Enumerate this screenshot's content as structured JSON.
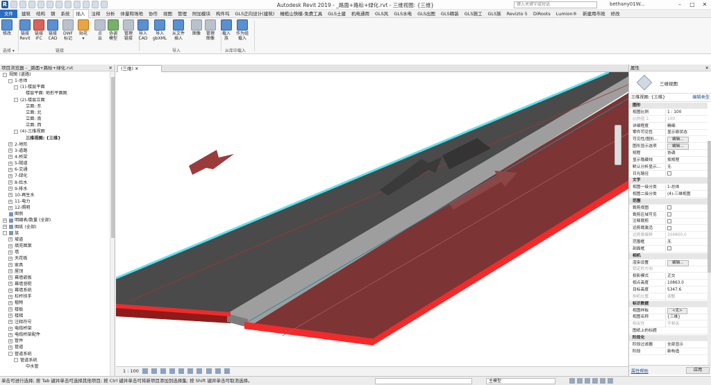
{
  "titlebar": {
    "title": "Autodesk Revit 2019 - _路面+路标+绿化.rvt - 三维视图: {三维}",
    "search_placeholder": "键入关键字或短语",
    "user": "bethany01W..."
  },
  "menu": [
    "文件",
    "建筑",
    "结构",
    "钢",
    "系统",
    "插入",
    "注释",
    "分析",
    "体量和场地",
    "协作",
    "视图",
    "管理",
    "附加模块",
    "构件坞",
    "GLS正向设计(建筑)",
    "橄榄山快模-免费工具",
    "GLS土建",
    "机电通用",
    "GLS风",
    "GLS水电",
    "GLS出图",
    "GLS精装",
    "GLS施工",
    "GLS族",
    "Revizto 5",
    "DiRoots",
    "Lumion®",
    "新建用市政",
    "修改"
  ],
  "menu_active": "插入",
  "ribbon": {
    "buttons": [
      {
        "label": "修改",
        "color": "blue"
      },
      {
        "label": "链接\nRevit",
        "color": "blue"
      },
      {
        "label": "链接\nIFC",
        "color": "red"
      },
      {
        "label": "链接\nCAD",
        "color": "blue"
      },
      {
        "label": "DWF\n标记",
        "color": "gray"
      },
      {
        "label": "贴花\n▾",
        "color": "orange"
      },
      {
        "label": "点\n云",
        "color": "gray"
      },
      {
        "label": "协调\n模型",
        "color": "green"
      },
      {
        "label": "管理\n链接",
        "color": "gray"
      },
      {
        "label": "导入\nCAD",
        "color": "blue"
      },
      {
        "label": "导入\ngbXML",
        "color": "blue"
      },
      {
        "label": "从文件\n插入",
        "color": "blue"
      },
      {
        "label": "图像",
        "color": "gray"
      },
      {
        "label": "管理\n图像",
        "color": "gray"
      },
      {
        "label": "载入\n族",
        "color": "blue"
      },
      {
        "label": "作为组\n载入",
        "color": "blue"
      }
    ],
    "panels": {
      "select": "选择 ▾",
      "link": "链接",
      "import": "导入",
      "load": "从库中载入"
    }
  },
  "browser": {
    "title": "项目浏览器 - _路面+路标+绿化.rvt",
    "items": [
      {
        "t": "视图 (道路)",
        "lvl": 0,
        "tog": "-"
      },
      {
        "t": "1-总体",
        "lvl": 1,
        "tog": "-"
      },
      {
        "t": "(1)-楼层平面",
        "lvl": 2,
        "tog": "-"
      },
      {
        "t": "楼层平面: 地形平面图",
        "lvl": 3,
        "tog": ""
      },
      {
        "t": "(2)-楼层立面",
        "lvl": 2,
        "tog": "-"
      },
      {
        "t": "立面: 东",
        "lvl": 3,
        "tog": ""
      },
      {
        "t": "立面: 北",
        "lvl": 3,
        "tog": ""
      },
      {
        "t": "立面: 南",
        "lvl": 3,
        "tog": ""
      },
      {
        "t": "立面: 西",
        "lvl": 3,
        "tog": ""
      },
      {
        "t": "(4)-三维视图",
        "lvl": 2,
        "tog": "-"
      },
      {
        "t": "三维视图: {三维}",
        "lvl": 3,
        "tog": "",
        "bold": true
      },
      {
        "t": "2-地形",
        "lvl": 1,
        "tog": "+"
      },
      {
        "t": "3-道路",
        "lvl": 1,
        "tog": "+"
      },
      {
        "t": "4-桥梁",
        "lvl": 1,
        "tog": "+"
      },
      {
        "t": "5-隧道",
        "lvl": 1,
        "tog": "+"
      },
      {
        "t": "6-交通",
        "lvl": 1,
        "tog": "+"
      },
      {
        "t": "7-绿化",
        "lvl": 1,
        "tog": "+"
      },
      {
        "t": "8-给水",
        "lvl": 1,
        "tog": "+"
      },
      {
        "t": "9-排水",
        "lvl": 1,
        "tog": "+"
      },
      {
        "t": "10-再生水",
        "lvl": 1,
        "tog": "+"
      },
      {
        "t": "11-电力",
        "lvl": 1,
        "tog": "+"
      },
      {
        "t": "12-照明",
        "lvl": 1,
        "tog": "+"
      },
      {
        "t": "图例",
        "lvl": 0,
        "tog": "",
        "icon": true
      },
      {
        "t": "明细表/数量 (全部)",
        "lvl": 0,
        "tog": "+",
        "icon": true
      },
      {
        "t": "图纸 (全部)",
        "lvl": 0,
        "tog": "+",
        "icon": true
      },
      {
        "t": "族",
        "lvl": 0,
        "tog": "-",
        "icon": true
      },
      {
        "t": "坡道",
        "lvl": 1,
        "tog": "+"
      },
      {
        "t": "填充图案",
        "lvl": 1,
        "tog": "+"
      },
      {
        "t": "墙",
        "lvl": 1,
        "tog": "+"
      },
      {
        "t": "天花板",
        "lvl": 1,
        "tog": "+"
      },
      {
        "t": "家具",
        "lvl": 1,
        "tog": "+"
      },
      {
        "t": "屋顶",
        "lvl": 1,
        "tog": "+"
      },
      {
        "t": "幕墙嵌板",
        "lvl": 1,
        "tog": "+"
      },
      {
        "t": "幕墙竖梃",
        "lvl": 1,
        "tog": "+"
      },
      {
        "t": "幕墙系统",
        "lvl": 1,
        "tog": "+"
      },
      {
        "t": "栏杆扶手",
        "lvl": 1,
        "tog": "+"
      },
      {
        "t": "植物",
        "lvl": 1,
        "tog": "+"
      },
      {
        "t": "楼板",
        "lvl": 1,
        "tog": "+"
      },
      {
        "t": "楼梯",
        "lvl": 1,
        "tog": "+"
      },
      {
        "t": "注释符号",
        "lvl": 1,
        "tog": "+"
      },
      {
        "t": "电缆桥架",
        "lvl": 1,
        "tog": "+"
      },
      {
        "t": "电缆桥架配件",
        "lvl": 1,
        "tog": "+"
      },
      {
        "t": "管件",
        "lvl": 1,
        "tog": "+"
      },
      {
        "t": "管道",
        "lvl": 1,
        "tog": "+"
      },
      {
        "t": "管道系统",
        "lvl": 1,
        "tog": "-"
      },
      {
        "t": "管道系统",
        "lvl": 2,
        "tog": "-"
      },
      {
        "t": "中水管",
        "lvl": 3,
        "tog": ""
      }
    ]
  },
  "view_tab": "(三维)",
  "view_status": {
    "scale": "1 : 100"
  },
  "properties": {
    "title": "属性",
    "type_name": "三维视图",
    "type_selector": "三维视图: {三维}",
    "edit_type": "编辑类型",
    "rows": [
      {
        "k": "图形",
        "g": true
      },
      {
        "k": "视图比例",
        "v": "1 : 100"
      },
      {
        "k": "比例值 1:",
        "v": "100",
        "dim": true
      },
      {
        "k": "详细程度",
        "v": "精细"
      },
      {
        "k": "零件可见性",
        "v": "显示原状态"
      },
      {
        "k": "可见性/图形...",
        "v": "编辑...",
        "btn": true
      },
      {
        "k": "图形显示选项",
        "v": "编辑...",
        "btn": true
      },
      {
        "k": "规程",
        "v": "协调"
      },
      {
        "k": "显示隐藏线",
        "v": "按规程"
      },
      {
        "k": "默认分析显示...",
        "v": "无"
      },
      {
        "k": "日光路径",
        "v": "",
        "cb": true
      },
      {
        "k": "文字",
        "g": true
      },
      {
        "k": "视图一级分类",
        "v": "1-总体"
      },
      {
        "k": "视图二级分类",
        "v": "(4)-三维视图"
      },
      {
        "k": "范围",
        "g": true
      },
      {
        "k": "裁剪视图",
        "v": "",
        "cb": true
      },
      {
        "k": "裁剪区域可见",
        "v": "",
        "cb": true
      },
      {
        "k": "注释裁剪",
        "v": "",
        "cb": true
      },
      {
        "k": "远剪裁激活",
        "v": "",
        "cb": true
      },
      {
        "k": "远剪裁偏移",
        "v": "304800.0",
        "dim": true
      },
      {
        "k": "范围框",
        "v": "无"
      },
      {
        "k": "剖面框",
        "v": "",
        "cb": true
      },
      {
        "k": "相机",
        "g": true
      },
      {
        "k": "渲染设置",
        "v": "编辑...",
        "btn": true
      },
      {
        "k": "锁定的方向",
        "v": "",
        "dim": true
      },
      {
        "k": "投影模式",
        "v": "正交"
      },
      {
        "k": "视点高度",
        "v": "10863.0"
      },
      {
        "k": "目标高度",
        "v": "5347.6"
      },
      {
        "k": "相机位置",
        "v": "调整",
        "dim": true
      },
      {
        "k": "标识数据",
        "g": true
      },
      {
        "k": "视图样板",
        "v": "<无>",
        "btn": true
      },
      {
        "k": "视图名称",
        "v": "{三维}"
      },
      {
        "k": "相关性",
        "v": "不相关",
        "dim": true
      },
      {
        "k": "图纸上的标题",
        "v": ""
      },
      {
        "k": "阶段化",
        "g": true
      },
      {
        "k": "阶段过滤器",
        "v": "全部显示"
      },
      {
        "k": "阶段",
        "v": "新构造"
      }
    ],
    "help": "属性帮助",
    "apply": "应用"
  },
  "statusbar": {
    "message": "单击可进行选择; 按 Tab 键并单击可选择其他项目; 按 Ctrl 键并单击可将新项目添加到选择集; 按 Shift 键并单击可取消选择。",
    "model": "主模型"
  },
  "colors": {
    "road_dark": "#4a4a4a",
    "road_red": "#7d3434",
    "median": "#9e9e9e",
    "edge_red": "#f22a2a",
    "edge_cyan": "#54e6f0"
  }
}
